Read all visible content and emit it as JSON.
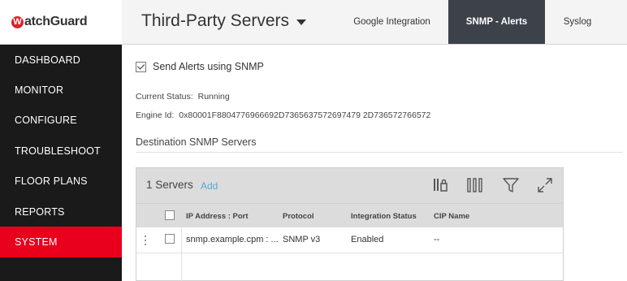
{
  "brand": {
    "logo_mark": "W",
    "logo_text": "atchGuard"
  },
  "sidebar": {
    "items": [
      {
        "label": "DASHBOARD",
        "active": false
      },
      {
        "label": "MONITOR",
        "active": false
      },
      {
        "label": "CONFIGURE",
        "active": false
      },
      {
        "label": "TROUBLESHOOT",
        "active": false
      },
      {
        "label": "FLOOR PLANS",
        "active": false
      },
      {
        "label": "REPORTS",
        "active": false
      },
      {
        "label": "SYSTEM",
        "active": true
      }
    ]
  },
  "header": {
    "title": "Third-Party Servers",
    "tabs": [
      {
        "label": "Google Integration",
        "active": false
      },
      {
        "label": "SNMP - Alerts",
        "active": true
      },
      {
        "label": "Syslog",
        "active": false
      }
    ]
  },
  "main": {
    "send_alerts_label": "Send Alerts using SNMP",
    "send_alerts_checked": true,
    "current_status_label": "Current Status:",
    "current_status_value": "Running",
    "engine_id_label": "Engine Id:",
    "engine_id_value": "0x80001F8804776966692D7365637572697479 2D736572766572",
    "section_title": "Destination SNMP Servers"
  },
  "grid": {
    "count_label": "1 Servers",
    "add_label": "Add",
    "toolbar_icons": [
      "column-lock-icon",
      "columns-icon",
      "filter-icon",
      "expand-icon"
    ],
    "columns": [
      "IP Address : Port",
      "Protocol",
      "Integration Status",
      "CIP Name"
    ],
    "rows": [
      {
        "ip": "snmp.example.cpm : ...",
        "protocol": "SNMP v3",
        "status": "Enabled",
        "cip": "--"
      }
    ]
  },
  "colors": {
    "sidebar_bg": "#1a1a1a",
    "active_nav": "#e8001c",
    "active_tab": "#3d4149",
    "link": "#5aa6d6",
    "brand_red": "#d9232d"
  }
}
